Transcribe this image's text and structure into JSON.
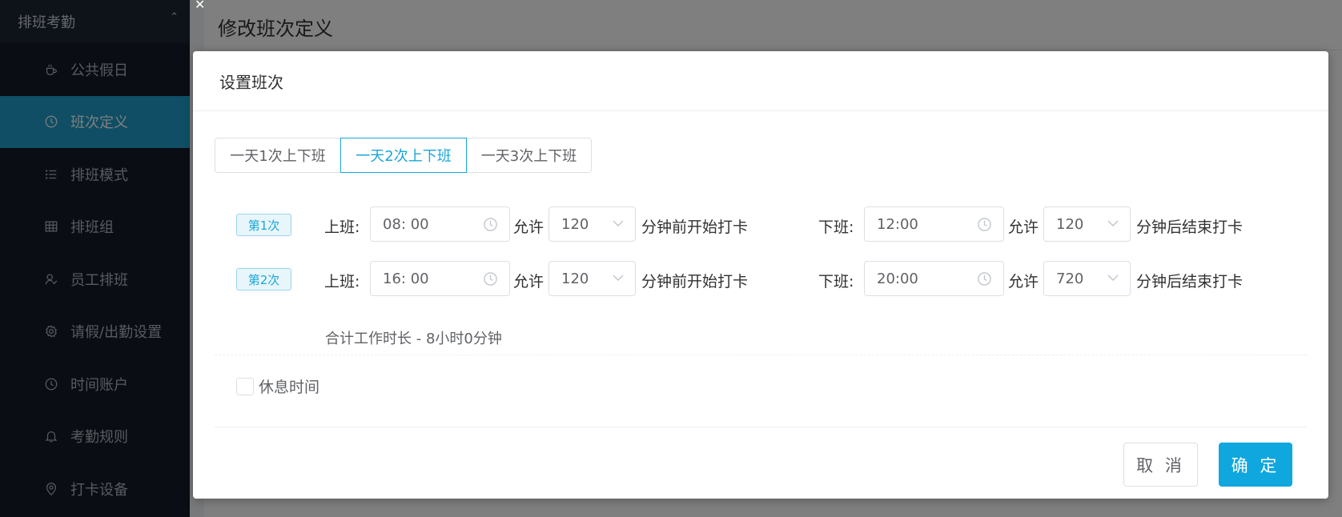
{
  "sidebar": {
    "section_title": "排班考勤",
    "items": [
      {
        "label": "公共假日",
        "icon": "coffee-icon"
      },
      {
        "label": "班次定义",
        "icon": "clock-icon"
      },
      {
        "label": "排班模式",
        "icon": "list-icon"
      },
      {
        "label": "排班组",
        "icon": "grid-icon"
      },
      {
        "label": "员工排班",
        "icon": "user-icon"
      },
      {
        "label": "请假/出勤设置",
        "icon": "gear-icon"
      },
      {
        "label": "时间账户",
        "icon": "clock-icon"
      },
      {
        "label": "考勤规则",
        "icon": "bell-icon"
      },
      {
        "label": "打卡设备",
        "icon": "location-icon"
      }
    ]
  },
  "page": {
    "title": "修改班次定义"
  },
  "dialog": {
    "title": "设置班次",
    "mode_options": [
      "一天1次上下班",
      "一天2次上下班",
      "一天3次上下班"
    ],
    "selected_mode": "一天2次上下班",
    "shifts": [
      {
        "tag": "第1次",
        "on_label": "上班:",
        "on_time": "08: 00",
        "allow_label": "允许",
        "on_minutes": "120",
        "on_suffix": "分钟前开始打卡",
        "off_label": "下班:",
        "off_time": "12:00",
        "allow_label2": "允许",
        "off_minutes": "120",
        "off_suffix": "分钟后结束打卡"
      },
      {
        "tag": "第2次",
        "on_label": "上班:",
        "on_time": "16: 00",
        "allow_label": "允许",
        "on_minutes": "120",
        "on_suffix": "分钟前开始打卡",
        "off_label": "下班:",
        "off_time": "20:00",
        "allow_label2": "允许",
        "off_minutes": "720",
        "off_suffix": "分钟后结束打卡"
      }
    ],
    "total_label": "合计工作时长 - 8小时0分钟",
    "rest_checkbox_label": "休息时间",
    "cancel_label": "取 消",
    "ok_label": "确 定"
  },
  "colors": {
    "accent": "#1aa6d8",
    "sidebar_active": "#1f9cc9",
    "sidebar_bg": "#141b26"
  }
}
